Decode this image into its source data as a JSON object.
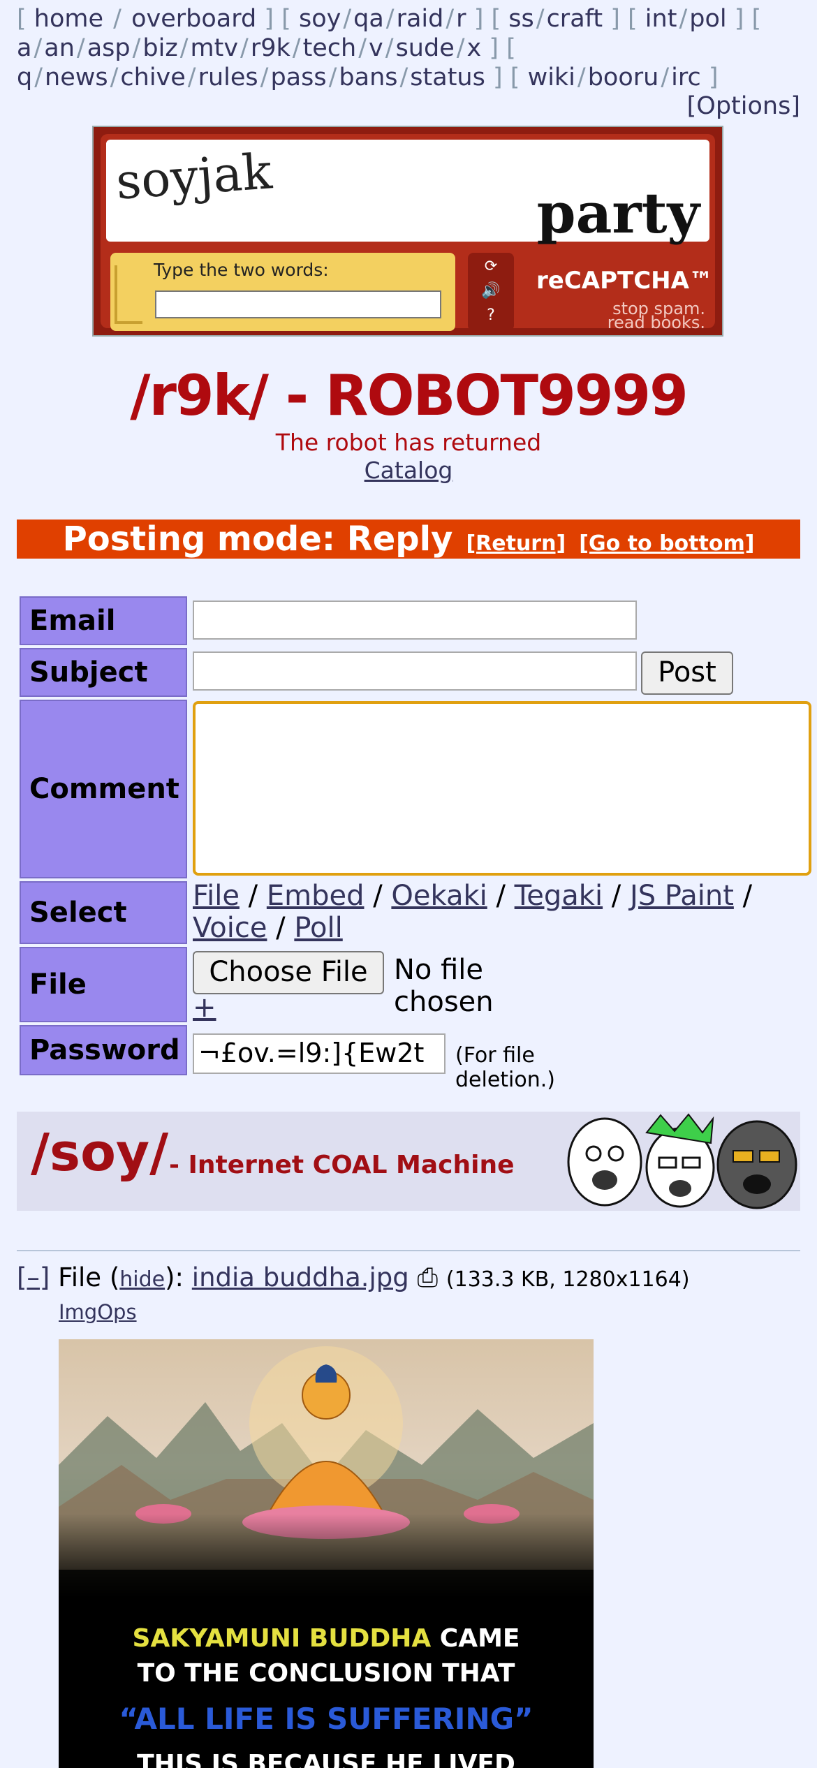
{
  "nav": {
    "groups": [
      [
        "home",
        "overboard"
      ],
      [
        "soy",
        "qa",
        "raid",
        "r"
      ],
      [
        "ss",
        "craft"
      ],
      [
        "int",
        "pol"
      ],
      [
        "a",
        "an",
        "asp",
        "biz",
        "mtv",
        "r9k",
        "tech",
        "v",
        "sude",
        "x"
      ],
      [
        "q",
        "news",
        "chive",
        "rules",
        "pass",
        "bans",
        "status"
      ],
      [
        "wiki",
        "booru",
        "irc"
      ]
    ],
    "options": "[Options]"
  },
  "banner": {
    "word1": "soyjak",
    "word2": "party",
    "prompt": "Type the two words:",
    "captcha_logo": "reCAPTCHA™",
    "captcha_sub1": "stop spam.",
    "captcha_sub2": "read books."
  },
  "board": {
    "title": "/r9k/ - ROBOT9999",
    "subtitle": "The robot has returned",
    "catalog": "Catalog"
  },
  "postmode": {
    "label": "Posting mode: Reply",
    "return": "[Return]",
    "bottom": "[Go to bottom]"
  },
  "form": {
    "email_label": "Email",
    "subject_label": "Subject",
    "post_button": "Post",
    "comment_label": "Comment",
    "select_label": "Select",
    "select_links": [
      "File",
      "Embed",
      "Oekaki",
      "Tegaki",
      "JS Paint",
      "Voice",
      "Poll"
    ],
    "file_label": "File",
    "choose_file": "Choose File",
    "no_file": "No file chosen",
    "plus": "+",
    "password_label": "Password",
    "password_value": "¬£ov.=l9:]{Ew2t",
    "password_note": "(For file deletion.)"
  },
  "soy_banner": {
    "big": "/soy/",
    "small": "- Internet COAL Machine"
  },
  "post": {
    "collapse": "[–]",
    "file_word": "File",
    "hide": "hide",
    "filename": "india buddha.jpg",
    "meta": "(133.3 KB, 1280x1164)",
    "imgops": "ImgOps",
    "image_text1": "SAKYAMUNI BUDDHA",
    "image_text1b": "CAME",
    "image_text2": "TO THE CONCLUSION THAT",
    "image_text3": "“ALL LIFE IS SUFFERING”",
    "image_text4": "THIS IS BECAUSE HE LIVED"
  }
}
